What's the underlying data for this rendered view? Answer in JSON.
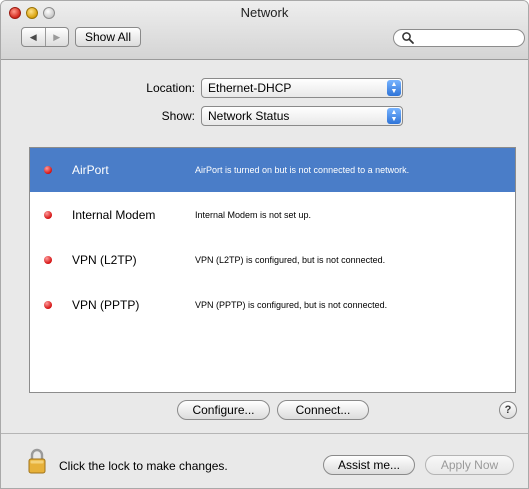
{
  "window": {
    "title": "Network"
  },
  "toolbar": {
    "back_glyph": "◀",
    "forward_glyph": "▶",
    "show_all_label": "Show All",
    "search_placeholder": ""
  },
  "location": {
    "label": "Location:",
    "value": "Ethernet-DHCP"
  },
  "show": {
    "label": "Show:",
    "value": "Network Status"
  },
  "services": [
    {
      "name": "AirPort",
      "status": "AirPort is turned on but is not connected to a network.",
      "selected": true,
      "indicator": "red"
    },
    {
      "name": "Internal Modem",
      "status": "Internal Modem is not set up.",
      "selected": false,
      "indicator": "red"
    },
    {
      "name": "VPN (L2TP)",
      "status": "VPN (L2TP) is configured, but is not connected.",
      "selected": false,
      "indicator": "red"
    },
    {
      "name": "VPN (PPTP)",
      "status": "VPN (PPTP) is configured, but is not connected.",
      "selected": false,
      "indicator": "red"
    }
  ],
  "actions": {
    "configure_label": "Configure...",
    "connect_label": "Connect...",
    "help_label": "?"
  },
  "footer": {
    "lock_text": "Click the lock to make changes.",
    "assist_label": "Assist me...",
    "apply_label": "Apply Now"
  },
  "colors": {
    "selection": "#4a7dc8",
    "indicator_red": "#d41111"
  },
  "icons": [
    "close-icon",
    "minimize-icon",
    "zoom-icon",
    "back-arrow-icon",
    "forward-arrow-icon",
    "search-icon",
    "status-dot-icon",
    "lock-icon",
    "help-icon"
  ]
}
